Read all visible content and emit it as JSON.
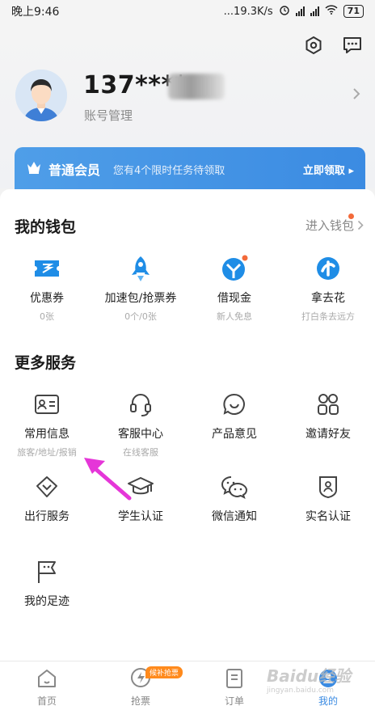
{
  "status_bar": {
    "time": "晚上9:46",
    "network_speed": "...19.3K/s",
    "battery": "71"
  },
  "header": {
    "settings_icon": "hexagon-settings-icon",
    "message_icon": "chat-bubble-icon"
  },
  "profile": {
    "phone_masked": "137****",
    "account_label": "账号管理"
  },
  "membership": {
    "title": "普通会员",
    "description": "您有4个限时任务待领取",
    "action": "立即领取"
  },
  "wallet": {
    "title": "我的钱包",
    "link": "进入钱包",
    "items": [
      {
        "label": "优惠券",
        "sub": "0张",
        "icon": "coupon-icon"
      },
      {
        "label": "加速包/抢票券",
        "sub": "0个/0张",
        "icon": "rocket-icon"
      },
      {
        "label": "借现金",
        "sub": "新人免息",
        "icon": "cash-loan-icon"
      },
      {
        "label": "拿去花",
        "sub": "打白条去远方",
        "icon": "credit-pay-icon"
      }
    ]
  },
  "services": {
    "title": "更多服务",
    "items": [
      {
        "label": "常用信息",
        "sub": "旅客/地址/报销",
        "icon": "id-card-icon"
      },
      {
        "label": "客服中心",
        "sub": "在线客服",
        "icon": "headset-icon"
      },
      {
        "label": "产品意见",
        "sub": "",
        "icon": "feedback-icon"
      },
      {
        "label": "邀请好友",
        "sub": "",
        "icon": "invite-friends-icon"
      },
      {
        "label": "出行服务",
        "sub": "",
        "icon": "travel-service-icon"
      },
      {
        "label": "学生认证",
        "sub": "",
        "icon": "graduation-cap-icon"
      },
      {
        "label": "微信通知",
        "sub": "",
        "icon": "wechat-icon"
      },
      {
        "label": "实名认证",
        "sub": "",
        "icon": "real-name-shield-icon"
      },
      {
        "label": "我的足迹",
        "sub": "",
        "icon": "footprint-flag-icon"
      }
    ]
  },
  "tabs": [
    {
      "label": "首页",
      "icon": "home-icon"
    },
    {
      "label": "抢票",
      "icon": "ticket-grab-icon",
      "badge": "候补抢票"
    },
    {
      "label": "订单",
      "icon": "order-list-icon"
    },
    {
      "label": "我的",
      "icon": "profile-icon"
    }
  ],
  "watermark": {
    "brand": "Baidu经验",
    "url": "jingyan.baidu.com"
  },
  "colors": {
    "accent": "#3b8be2",
    "member_banner": "#4a97e6",
    "annotation_arrow": "#e536d8",
    "badge": "#ff8a1c"
  }
}
